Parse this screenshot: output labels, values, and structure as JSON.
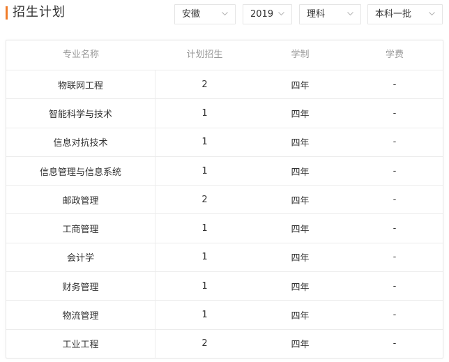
{
  "header": {
    "title": "招生计划"
  },
  "filters": {
    "province": "安徽",
    "year": "2019",
    "subject": "理科",
    "batch": "本科一批"
  },
  "table": {
    "columns": [
      "专业名称",
      "计划招生",
      "学制",
      "学费"
    ],
    "rows": [
      [
        "物联网工程",
        "2",
        "四年",
        "-"
      ],
      [
        "智能科学与技术",
        "1",
        "四年",
        "-"
      ],
      [
        "信息对抗技术",
        "1",
        "四年",
        "-"
      ],
      [
        "信息管理与信息系统",
        "1",
        "四年",
        "-"
      ],
      [
        "邮政管理",
        "2",
        "四年",
        "-"
      ],
      [
        "工商管理",
        "1",
        "四年",
        "-"
      ],
      [
        "会计学",
        "1",
        "四年",
        "-"
      ],
      [
        "财务管理",
        "1",
        "四年",
        "-"
      ],
      [
        "物流管理",
        "1",
        "四年",
        "-"
      ],
      [
        "工业工程",
        "2",
        "四年",
        "-"
      ]
    ]
  },
  "colors": {
    "accent": "#f07c2a",
    "header_text": "#999999",
    "body_text": "#333333",
    "border": "#ececec"
  }
}
